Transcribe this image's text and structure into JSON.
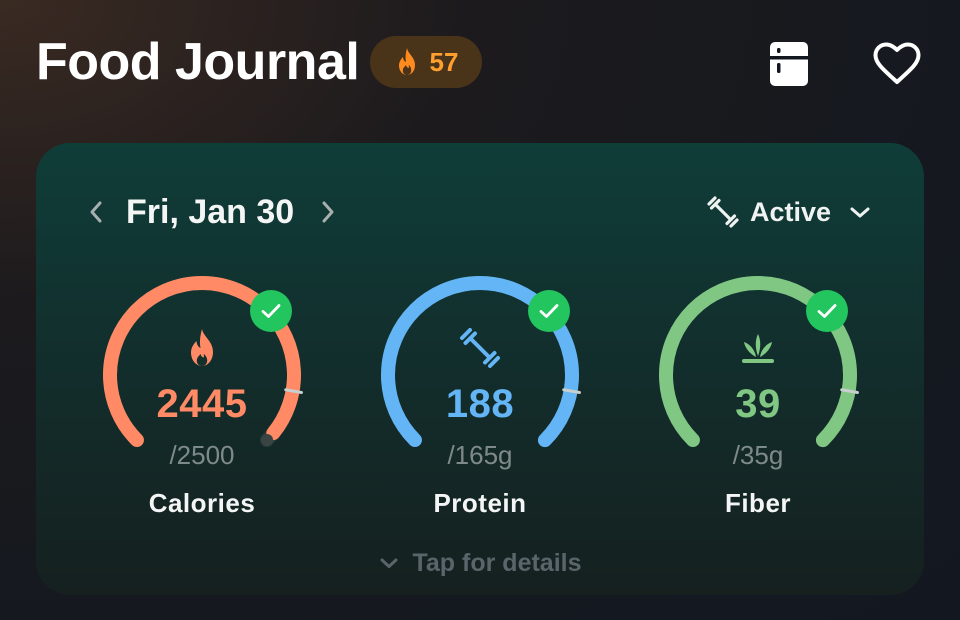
{
  "header": {
    "title": "Food Journal",
    "streak_count": "57",
    "streak_icon": "flame-icon",
    "actions": [
      {
        "name": "fridge-icon"
      },
      {
        "name": "heart-icon"
      }
    ]
  },
  "card": {
    "date": "Fri, Jan 30",
    "activity_level": "Active",
    "footer_label": "Tap for details",
    "gauges": [
      {
        "key": "calories",
        "label": "Calories",
        "value": "2445",
        "target": "/2500",
        "icon": "flame-icon",
        "color": "#ff8a65",
        "progress": 0.978,
        "goal_met": true
      },
      {
        "key": "protein",
        "label": "Protein",
        "value": "188",
        "target": "/165g",
        "icon": "dumbbell-icon",
        "color": "#64b5f6",
        "progress": 1.0,
        "goal_met": true
      },
      {
        "key": "fiber",
        "label": "Fiber",
        "value": "39",
        "target": "/35g",
        "icon": "sprout-icon",
        "color": "#81c784",
        "progress": 1.0,
        "goal_met": true
      }
    ]
  },
  "colors": {
    "accent_orange": "#ff9f2e",
    "success_green": "#22c55e",
    "card_top": "#0f3d38"
  }
}
